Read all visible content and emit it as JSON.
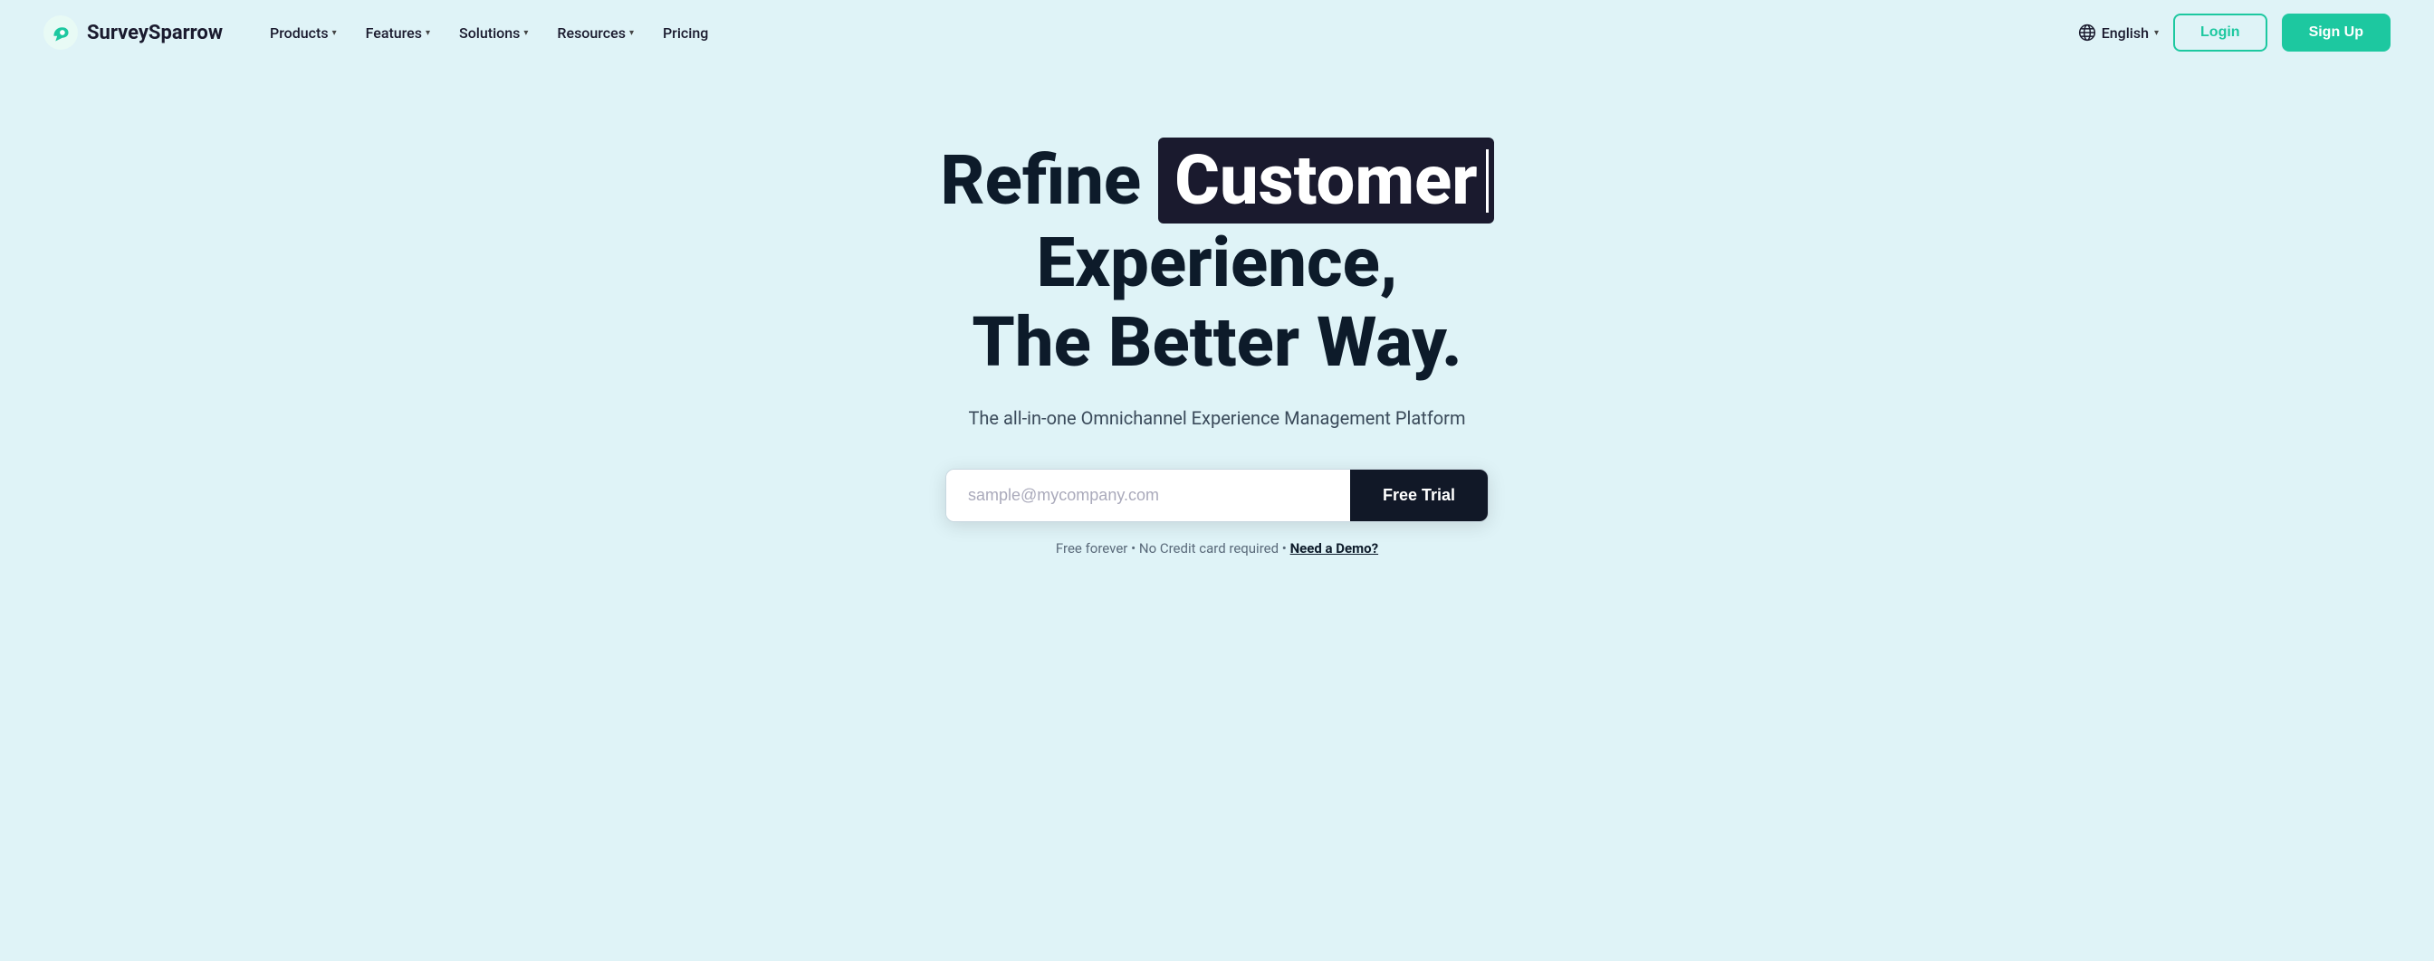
{
  "brand": {
    "name": "SurveySparrow",
    "logo_alt": "SurveySparrow logo"
  },
  "nav": {
    "links": [
      {
        "label": "Products",
        "has_dropdown": true
      },
      {
        "label": "Features",
        "has_dropdown": true
      },
      {
        "label": "Solutions",
        "has_dropdown": true
      },
      {
        "label": "Resources",
        "has_dropdown": true
      },
      {
        "label": "Pricing",
        "has_dropdown": false
      }
    ],
    "language": "English",
    "login_label": "Login",
    "signup_label": "Sign Up"
  },
  "hero": {
    "title_start": "Refine ",
    "title_highlight": "Customer",
    "title_end": " Experience,",
    "title_line2": "The Better Way.",
    "subtitle": "The all-in-one Omnichannel Experience Management Platform",
    "email_placeholder": "sample@mycompany.com",
    "cta_label": "Free Trial",
    "footnote_text": "Free forever • No Credit card required •",
    "footnote_link": "Need a Demo?"
  }
}
